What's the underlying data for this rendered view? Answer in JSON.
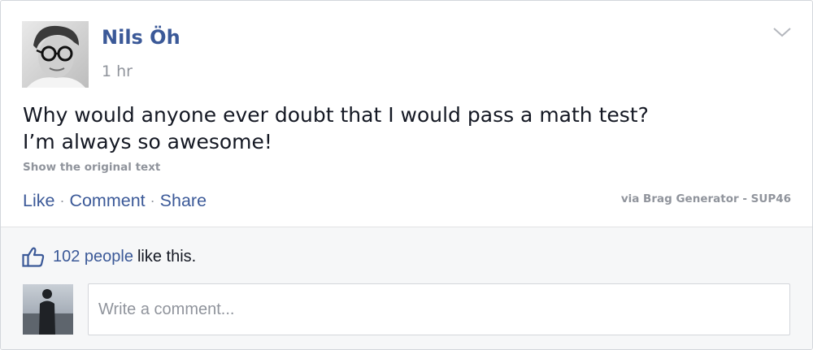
{
  "post": {
    "author": "Nils Öh",
    "time": "1 hr",
    "text_lines": [
      "Why would anyone ever doubt that I would pass a math test?",
      "I’m always so awesome!"
    ],
    "show_original": "Show the original text",
    "via": "via Brag Generator - SUP46"
  },
  "actions": {
    "like": "Like",
    "separator": "·",
    "comment": "Comment",
    "share": "Share"
  },
  "likes": {
    "count_link": "102 people",
    "suffix": "like this."
  },
  "comment_box": {
    "placeholder": "Write a comment..."
  },
  "colors": {
    "link_blue": "#3b5998",
    "meta_gray": "#90949c",
    "text_dark": "#141823",
    "feedback_bg": "#f6f7f8"
  },
  "icons": [
    "chevron-down-icon",
    "thumbs-up-icon"
  ]
}
